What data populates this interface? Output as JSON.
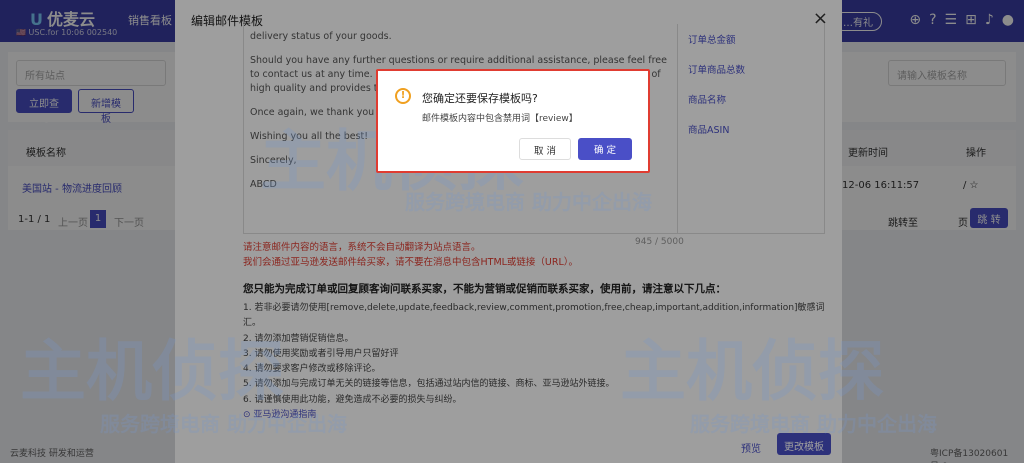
{
  "app": {
    "logo": "优麦云",
    "account_info": "🇺🇸 USC.for 10:06 002540",
    "nav_tab": "销售看板",
    "top_button": "…有礼"
  },
  "page": {
    "filter_placeholder": "所有站点",
    "search_placeholder": "请输入模板名称",
    "query_button": "立即查询",
    "new_button": "新增模板",
    "col_name": "模板名称",
    "col_time": "更新时间",
    "col_action": "操作",
    "row_name": "美国站 - 物流进度回顾",
    "row_time": "12-06 16:11:57",
    "pagination": "1-1 / 1",
    "prev": "上一页",
    "page_num": "1",
    "next": "下一页",
    "goto_label": "跳转至",
    "page_unit": "页",
    "goto_button": "跳 转"
  },
  "footer": {
    "left": "云麦科技 研发和运营",
    "right": "粤ICP备13020601号-9"
  },
  "modal": {
    "title": "编辑邮件模板",
    "close": "×",
    "editor_lines": [
      "delivery status of your goods.",
      "Should you have any further questions or require additional assistance, please feel free to contact us at any time. We are committed to ensure your shopping experience is of high quality and provides the best quality of service.",
      "Once again, we thank you for y…",
      "Wishing you all the best!",
      "Sincerely,",
      "ABCD"
    ],
    "variables": [
      "订单总金额",
      "订单商品总数",
      "商品名称",
      "商品ASIN"
    ],
    "char_count": "945 / 5000",
    "warning1": "请注意邮件内容的语言，系统不会自动翻译为站点语言。",
    "warning2": "我们会通过亚马逊发送邮件给买家，请不要在消息中包含HTML或链接（URL）。",
    "rules_title": "您只能为完成订单或回复顾客询问联系买家，不能为营销或促销而联系买家，使用前，请注意以下几点：",
    "rules": [
      "1. 若非必要请勿使用[remove,delete,update,feedback,review,comment,promotion,free,cheap,important,addition,information]敏感词汇。",
      "2. 请勿添加营销促销信息。",
      "3. 请勿使用奖励或者引导用户只留好评",
      "4. 请勿要求客户修改或移除评论。",
      "5. 请勿添加与完成订单无关的链接等信息，包括通过站内信的链接、商标、亚马逊站外链接。",
      "6. 请谨慎使用此功能，避免造成不必要的损失与纠纷。"
    ],
    "policy_link": "⊙ 亚马逊沟通指南",
    "preview": "预览",
    "save": "更改模板"
  },
  "confirm": {
    "icon": "warning-icon",
    "title": "您确定还要保存模板吗?",
    "message": "邮件模板内容中包含禁用词【review】",
    "cancel": "取 消",
    "ok": "确 定"
  },
  "watermark": {
    "brand": "主机侦探",
    "slogan": "服务跨境电商  助力中企出海"
  }
}
